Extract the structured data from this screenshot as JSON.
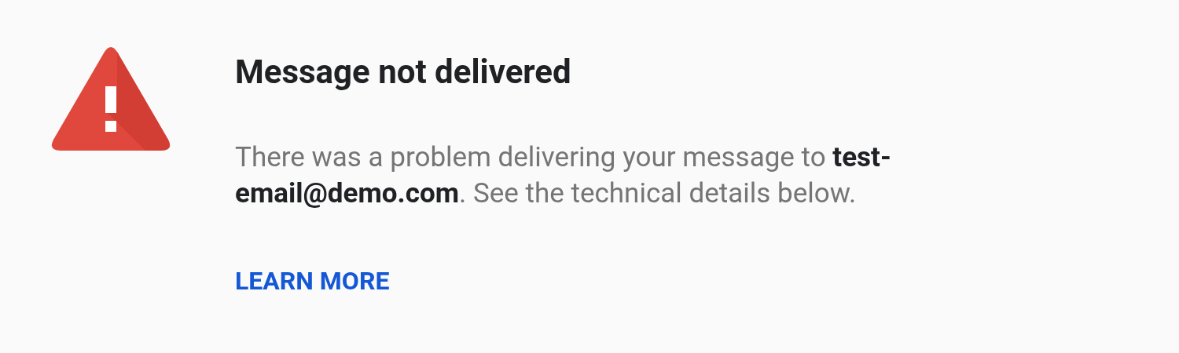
{
  "title": "Message not delivered",
  "message": "There was a problem delivering your message to **test-email@demo.com**. See the technical details below.",
  "link": {
    "label": "LEARN MORE"
  }
}
